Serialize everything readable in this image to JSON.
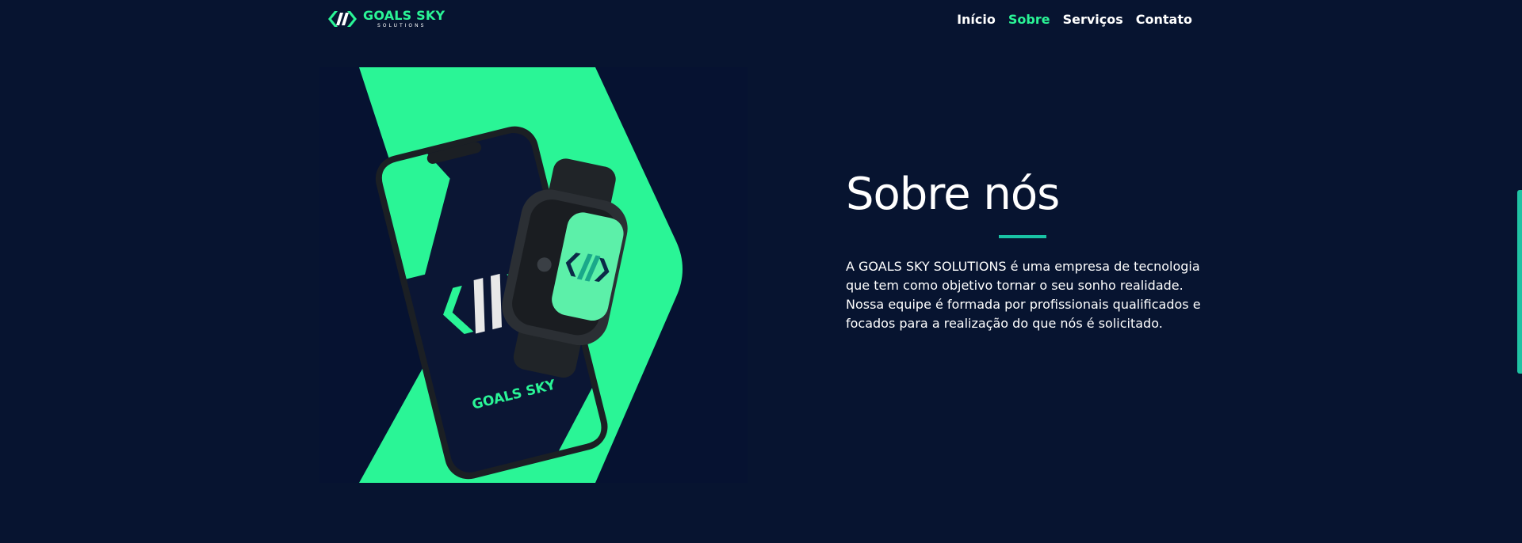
{
  "header": {
    "logo": {
      "main": "GOALS SKY",
      "sub": "SOLUTIONS"
    },
    "nav": [
      {
        "label": "Início",
        "active": false
      },
      {
        "label": "Sobre",
        "active": true
      },
      {
        "label": "Serviços",
        "active": false
      },
      {
        "label": "Contato",
        "active": false
      }
    ]
  },
  "hero": {
    "phone_brand_text": "GOALS SKY"
  },
  "about": {
    "title": "Sobre nós",
    "text": "A GOALS SKY SOLUTIONS é uma empresa de tecnologia que tem como objetivo tornar o seu sonho realidade. Nossa equipe é formada por profissionais qualificados e focados para a realização do que nós é solicitado."
  },
  "colors": {
    "background": "#071430",
    "accent": "#2af596",
    "underline": "#19c3a4",
    "text": "#ffffff"
  },
  "icons": [
    "goals-sky-logo-icon"
  ]
}
